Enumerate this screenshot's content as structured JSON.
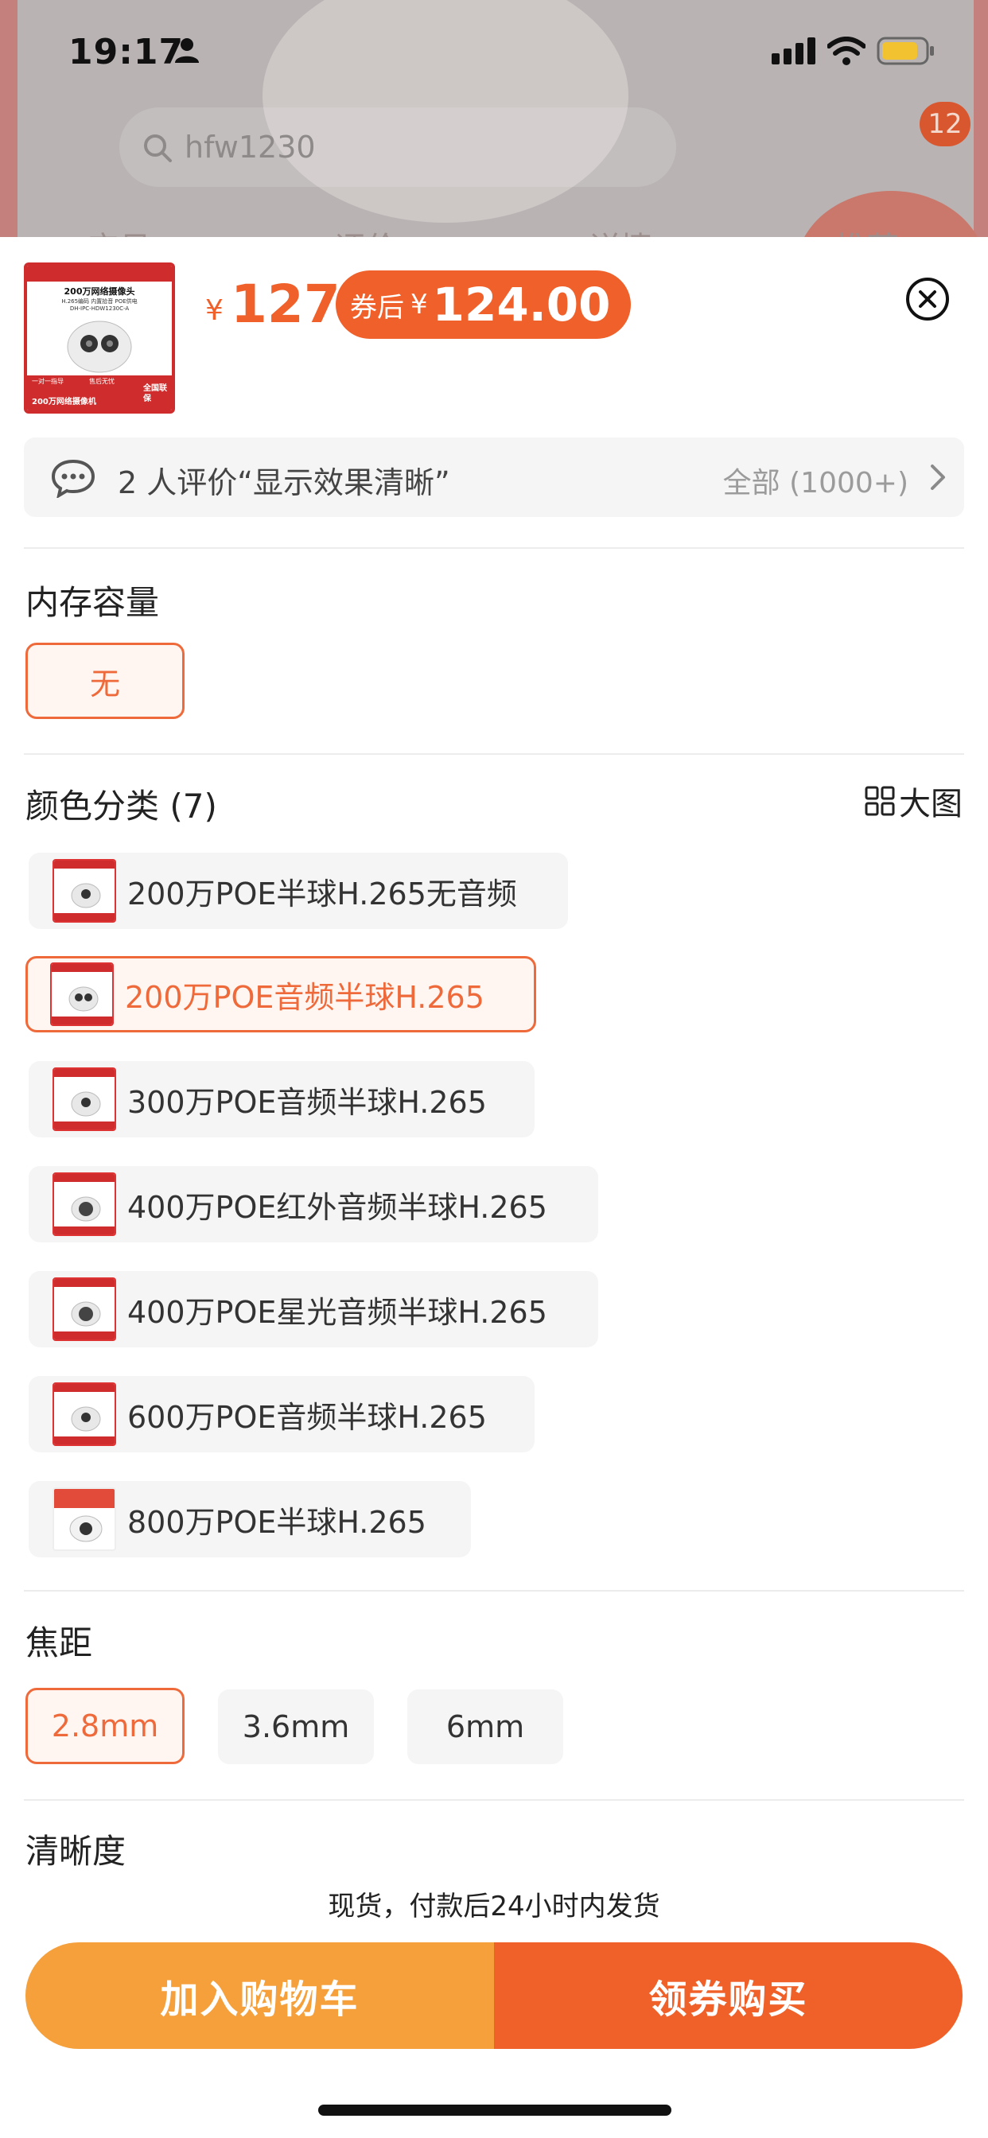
{
  "status_bar": {
    "time": "19:17"
  },
  "background": {
    "search_text": "hfw1230",
    "cart_badge": "12",
    "tabs": [
      "宝贝",
      "评价",
      "详情",
      "推荐"
    ]
  },
  "product": {
    "price_symbol": "¥",
    "price": "127",
    "coupon_label": "券后",
    "coupon_symbol": "¥",
    "coupon_price": "124.00",
    "thumb_lines": [
      "200万网络摄像头",
      "H.265编码 内置拾音 POE供电",
      "DH-IPC-HDW1230C-A",
      "一对一指导",
      "售后无忧",
      "200万网络摄像机",
      "全国联保"
    ]
  },
  "review": {
    "text": "2 人评价“显示效果清晰”",
    "all_label": "全部 (1000+)"
  },
  "memory": {
    "title": "内存容量",
    "options": [
      "无"
    ]
  },
  "color": {
    "title": "颜色分类 (7)",
    "big_image_label": "大图",
    "options": [
      "200万POE半球H.265无音频",
      "200万POE音频半球H.265",
      "300万POE音频半球H.265",
      "400万POE红外音频半球H.265",
      "400万POE星光音频半球H.265",
      "600万POE音频半球H.265",
      "800万POE半球H.265"
    ]
  },
  "focal": {
    "title": "焦距",
    "options": [
      "2.8mm",
      "3.6mm",
      "6mm"
    ]
  },
  "clarity": {
    "title": "清晰度"
  },
  "shipping_note": "现货，付款后24小时内发货",
  "actions": {
    "add_to_cart": "加入购物车",
    "buy_with_coupon": "领券购买"
  },
  "colors": {
    "accent": "#ef6129",
    "cart_button": "#f5a03a"
  }
}
